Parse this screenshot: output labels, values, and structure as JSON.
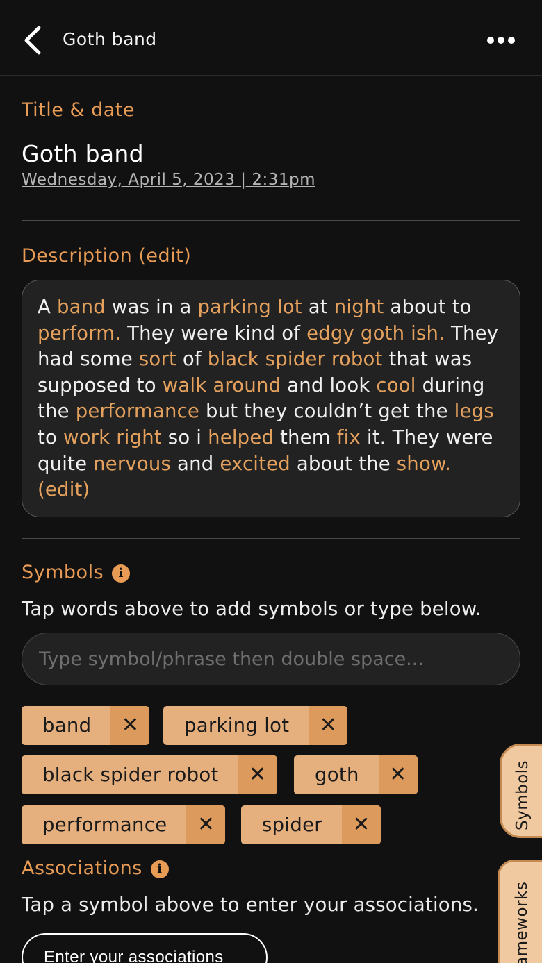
{
  "header": {
    "title": "Goth band"
  },
  "title_section": {
    "label": "Title & date",
    "entry_title": "Goth band",
    "date": "Wednesday, April 5, 2023 | 2:31pm"
  },
  "description_section": {
    "label": "Description (edit)",
    "segments": [
      {
        "text": "A ",
        "hl": false
      },
      {
        "text": "band",
        "hl": true
      },
      {
        "text": " was in a ",
        "hl": false
      },
      {
        "text": "parking lot",
        "hl": true
      },
      {
        "text": " at ",
        "hl": false
      },
      {
        "text": "night",
        "hl": true
      },
      {
        "text": " about to ",
        "hl": false
      },
      {
        "text": "perform.",
        "hl": true
      },
      {
        "text": " They were kind of ",
        "hl": false
      },
      {
        "text": "edgy goth ish.",
        "hl": true
      },
      {
        "text": " They had some ",
        "hl": false
      },
      {
        "text": "sort",
        "hl": true
      },
      {
        "text": " of ",
        "hl": false
      },
      {
        "text": "black spider robot",
        "hl": true
      },
      {
        "text": " that was supposed to ",
        "hl": false
      },
      {
        "text": "walk around",
        "hl": true
      },
      {
        "text": " and look ",
        "hl": false
      },
      {
        "text": "cool",
        "hl": true
      },
      {
        "text": " during the ",
        "hl": false
      },
      {
        "text": "performance",
        "hl": true
      },
      {
        "text": " but they couldn’t get the ",
        "hl": false
      },
      {
        "text": "legs",
        "hl": true
      },
      {
        "text": " to ",
        "hl": false
      },
      {
        "text": "work right",
        "hl": true
      },
      {
        "text": " so i ",
        "hl": false
      },
      {
        "text": "helped",
        "hl": true
      },
      {
        "text": " them ",
        "hl": false
      },
      {
        "text": "fix",
        "hl": true
      },
      {
        "text": " it. They were quite ",
        "hl": false
      },
      {
        "text": "nervous",
        "hl": true
      },
      {
        "text": " and ",
        "hl": false
      },
      {
        "text": "excited",
        "hl": true
      },
      {
        "text": " about the ",
        "hl": false
      },
      {
        "text": "show.",
        "hl": true
      },
      {
        "text": " (edit)",
        "hl": true
      }
    ]
  },
  "symbols_section": {
    "label": "Symbols",
    "info_glyph": "i",
    "help": "Tap words above to add symbols or type below.",
    "input_placeholder": "Type symbol/phrase then double space...",
    "remove_glyph": "✕",
    "chips": [
      "band",
      "parking lot",
      "black spider robot",
      "goth",
      "performance",
      "spider"
    ]
  },
  "associations_section": {
    "label": "Associations",
    "info_glyph": "i",
    "help": "Tap a symbol above to enter your associations.",
    "button": "Enter your associations"
  },
  "side_tabs": {
    "symbols": "Symbols",
    "frameworks": "Frameworks"
  },
  "colors": {
    "accent": "#e89b55",
    "chip_bg": "#e6b07e",
    "chip_remove_bg": "#dc9a5c",
    "background": "#111111"
  }
}
